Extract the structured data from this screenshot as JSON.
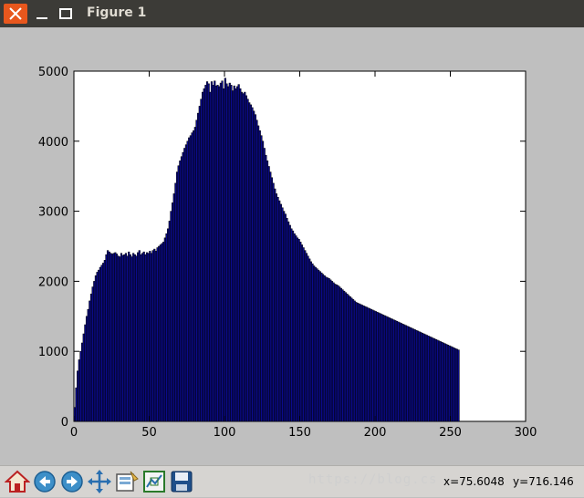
{
  "window": {
    "title": "Figure 1"
  },
  "toolbar": {
    "buttons": [
      {
        "icon": "home-icon",
        "label": "Home"
      },
      {
        "icon": "back-arrow-icon",
        "label": "Back"
      },
      {
        "icon": "forward-arrow-icon",
        "label": "Forward"
      },
      {
        "icon": "pan-icon",
        "label": "Pan"
      },
      {
        "icon": "zoom-rect-icon",
        "label": "Zoom"
      },
      {
        "icon": "subplots-icon",
        "label": "Subplots"
      },
      {
        "icon": "save-icon",
        "label": "Save"
      }
    ],
    "x_readout": "x=75.6048",
    "y_readout": "y=716.146",
    "watermark": "https://blog.cs"
  },
  "colors": {
    "bar_fill": "#0a0a8c",
    "titlebar": "#3c3b37",
    "close": "#e8571d",
    "toolbar_bg": "#d6d4d1"
  },
  "chart_data": {
    "type": "bar",
    "title": "",
    "xlabel": "",
    "ylabel": "",
    "xlim": [
      0,
      300
    ],
    "ylim": [
      0,
      5000
    ],
    "x_ticks": [
      0,
      50,
      100,
      150,
      200,
      250,
      300
    ],
    "y_ticks": [
      0,
      1000,
      2000,
      3000,
      4000,
      5000
    ],
    "grid": false,
    "bin_start": 0,
    "bin_width": 1,
    "values": [
      200,
      480,
      720,
      880,
      1000,
      1120,
      1250,
      1380,
      1500,
      1600,
      1720,
      1820,
      1920,
      2000,
      2080,
      2130,
      2160,
      2200,
      2230,
      2260,
      2300,
      2380,
      2440,
      2420,
      2400,
      2390,
      2400,
      2410,
      2390,
      2360,
      2350,
      2400,
      2370,
      2380,
      2400,
      2360,
      2420,
      2380,
      2350,
      2400,
      2380,
      2360,
      2410,
      2440,
      2380,
      2400,
      2420,
      2380,
      2410,
      2400,
      2430,
      2400,
      2440,
      2460,
      2430,
      2480,
      2500,
      2520,
      2540,
      2560,
      2620,
      2680,
      2750,
      2860,
      3000,
      3120,
      3250,
      3400,
      3560,
      3650,
      3720,
      3780,
      3840,
      3900,
      3950,
      4000,
      4050,
      4080,
      4120,
      4150,
      4200,
      4300,
      4400,
      4500,
      4600,
      4700,
      4750,
      4800,
      4850,
      4820,
      4700,
      4850,
      4800,
      4860,
      4790,
      4800,
      4780,
      4830,
      4860,
      4750,
      4900,
      4820,
      4780,
      4830,
      4800,
      4720,
      4790,
      4750,
      4780,
      4810,
      4750,
      4700,
      4680,
      4700,
      4650,
      4600,
      4550,
      4520,
      4480,
      4430,
      4380,
      4300,
      4220,
      4150,
      4080,
      4000,
      3900,
      3800,
      3720,
      3640,
      3560,
      3480,
      3400,
      3320,
      3250,
      3200,
      3150,
      3100,
      3050,
      3000,
      2960,
      2900,
      2850,
      2800,
      2750,
      2720,
      2680,
      2650,
      2620,
      2600,
      2560,
      2520,
      2480,
      2440,
      2400,
      2360,
      2320,
      2280,
      2250,
      2220,
      2200,
      2180,
      2160,
      2140,
      2120,
      2100,
      2080,
      2060,
      2050,
      2040,
      2020,
      2000,
      1980,
      1960,
      1950,
      1940,
      1920,
      1900,
      1880,
      1860,
      1840,
      1820,
      1800,
      1780,
      1760,
      1740,
      1720,
      1700,
      1690,
      1680,
      1670,
      1660,
      1650,
      1640,
      1630,
      1620,
      1610,
      1600,
      1590,
      1580,
      1570,
      1560,
      1550,
      1540,
      1530,
      1520,
      1510,
      1500,
      1490,
      1480,
      1470,
      1460,
      1450,
      1440,
      1430,
      1420,
      1410,
      1400,
      1390,
      1380,
      1370,
      1360,
      1350,
      1340,
      1330,
      1320,
      1310,
      1300,
      1290,
      1280,
      1270,
      1260,
      1250,
      1240,
      1230,
      1220,
      1210,
      1200,
      1190,
      1180,
      1170,
      1160,
      1150,
      1140,
      1130,
      1120,
      1110,
      1100,
      1090,
      1080,
      1070,
      1060,
      1050,
      1040,
      1030,
      1020
    ]
  }
}
